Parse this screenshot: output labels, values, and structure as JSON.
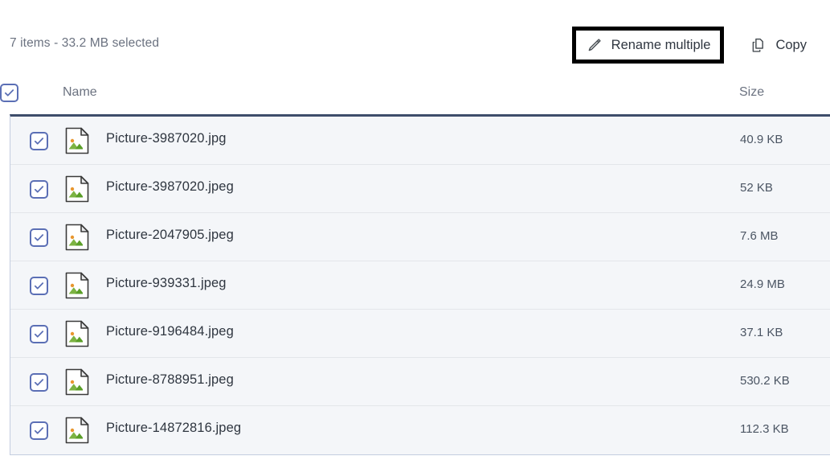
{
  "toolbar": {
    "selection_summary": "7 items - 33.2 MB selected",
    "rename_button": {
      "label": "Rename multiple",
      "icon": "pencil-icon",
      "highlighted": true,
      "highlight_color": "#000000"
    },
    "copy_button": {
      "label": "Copy",
      "icon": "copy-icon"
    }
  },
  "table": {
    "select_all_checked": true,
    "columns": [
      {
        "key": "name",
        "label": "Name"
      },
      {
        "key": "size",
        "label": "Size"
      }
    ],
    "rows": [
      {
        "name": "Picture-3987020.jpg",
        "size": "40.9 KB",
        "checked": true,
        "icon": "image-file-icon"
      },
      {
        "name": "Picture-3987020.jpeg",
        "size": "52 KB",
        "checked": true,
        "icon": "image-file-icon"
      },
      {
        "name": "Picture-2047905.jpeg",
        "size": "7.6 MB",
        "checked": true,
        "icon": "image-file-icon"
      },
      {
        "name": "Picture-939331.jpeg",
        "size": "24.9 MB",
        "checked": true,
        "icon": "image-file-icon"
      },
      {
        "name": "Picture-9196484.jpeg",
        "size": "37.1 KB",
        "checked": true,
        "icon": "image-file-icon"
      },
      {
        "name": "Picture-8788951.jpeg",
        "size": "530.2 KB",
        "checked": true,
        "icon": "image-file-icon"
      },
      {
        "name": "Picture-14872816.jpeg",
        "size": "112.3 KB",
        "checked": true,
        "icon": "image-file-icon"
      }
    ]
  },
  "colors": {
    "checkbox_accent": "#5b6fb5",
    "row_background": "#f4f6f9",
    "table_top_border": "#3e4d6b",
    "text_primary": "#2f3640",
    "text_muted": "#6b7280",
    "icon_sun": "#e8962e",
    "icon_hill": "#7cb342"
  }
}
